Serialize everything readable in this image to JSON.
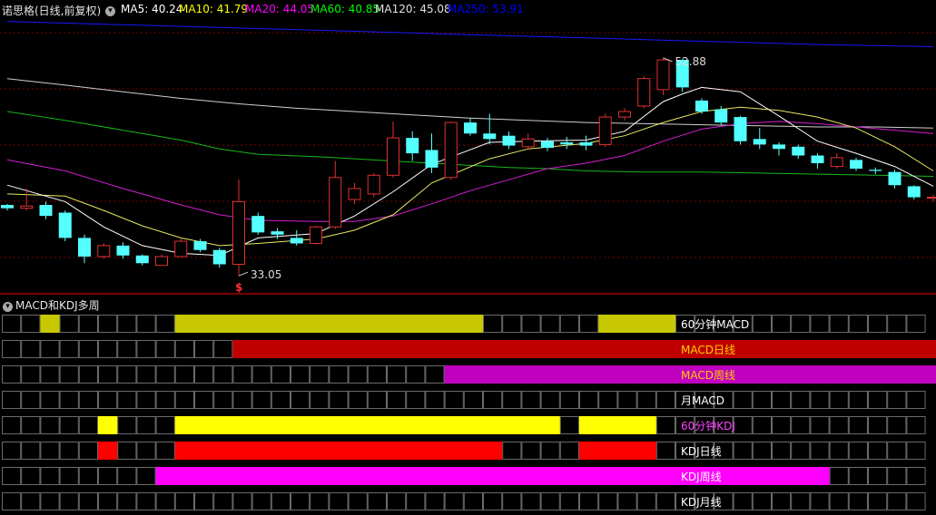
{
  "header": {
    "title": "诺思格(日线,前复权)",
    "ma": [
      {
        "label": "MA5: 40.24",
        "color": "#ffffff"
      },
      {
        "label": "MA10: 41.79",
        "color": "#ffff00"
      },
      {
        "label": "MA20: 44.05",
        "color": "#ff00ff"
      },
      {
        "label": "MA60: 40.85",
        "color": "#00ff00"
      },
      {
        "label": "MA120: 45.08",
        "color": "#e0e0e0"
      },
      {
        "label": "MA250: 53.91",
        "color": "#0000ff"
      }
    ]
  },
  "chart_data": {
    "type": "candlestick",
    "price_range": [
      31.5,
      56.5
    ],
    "high_label": "52.88",
    "low_label": "33.05",
    "signal_mark": "$",
    "up_color": "#e03030",
    "down_color": "#54ffff",
    "candles": [
      [
        39.5,
        39.2,
        39.6,
        39.0
      ],
      [
        39.2,
        39.4,
        41.0,
        39.0
      ],
      [
        39.5,
        38.5,
        39.8,
        38.2
      ],
      [
        38.8,
        36.5,
        39.0,
        36.2
      ],
      [
        36.5,
        34.8,
        36.8,
        34.2
      ],
      [
        34.8,
        35.8,
        36.0,
        34.6
      ],
      [
        35.8,
        34.9,
        36.1,
        34.6
      ],
      [
        34.9,
        34.2,
        35.0,
        34.0
      ],
      [
        34.0,
        34.8,
        35.0,
        34.0
      ],
      [
        34.8,
        36.2,
        36.5,
        34.8
      ],
      [
        36.2,
        35.4,
        36.4,
        35.2
      ],
      [
        35.4,
        34.1,
        35.6,
        33.8
      ],
      [
        34.1,
        39.8,
        41.8,
        33.05
      ],
      [
        38.5,
        37.0,
        38.8,
        36.8
      ],
      [
        37.1,
        36.8,
        37.4,
        36.4
      ],
      [
        36.5,
        36.0,
        37.2,
        35.8
      ],
      [
        36.0,
        37.5,
        37.6,
        35.9
      ],
      [
        37.5,
        42.0,
        43.5,
        37.3
      ],
      [
        40.0,
        41.0,
        41.5,
        39.6
      ],
      [
        40.5,
        42.2,
        42.4,
        40.2
      ],
      [
        42.2,
        45.6,
        47.1,
        42.0
      ],
      [
        45.6,
        44.2,
        46.2,
        43.5
      ],
      [
        44.5,
        42.9,
        46.0,
        42.4
      ],
      [
        42.0,
        47.0,
        47.1,
        41.8
      ],
      [
        47.0,
        46.0,
        47.4,
        45.8
      ],
      [
        46.0,
        45.5,
        47.8,
        45.0
      ],
      [
        45.8,
        44.9,
        46.2,
        44.6
      ],
      [
        44.8,
        45.5,
        46.0,
        44.5
      ],
      [
        45.3,
        44.7,
        45.6,
        44.4
      ],
      [
        45.2,
        45.0,
        45.7,
        44.6
      ],
      [
        45.2,
        44.9,
        45.8,
        44.5
      ],
      [
        45.0,
        47.5,
        47.8,
        44.8
      ],
      [
        47.5,
        48.0,
        48.3,
        47.2
      ],
      [
        48.5,
        51.0,
        51.2,
        48.3
      ],
      [
        50.0,
        52.7,
        52.88,
        49.5
      ],
      [
        52.7,
        50.2,
        52.8,
        49.8
      ],
      [
        49.0,
        48.0,
        49.2,
        47.8
      ],
      [
        48.2,
        47.0,
        48.5,
        46.8
      ],
      [
        47.5,
        45.3,
        47.6,
        45.0
      ],
      [
        45.5,
        45.0,
        46.5,
        44.6
      ],
      [
        45.0,
        44.6,
        45.2,
        44.0
      ],
      [
        44.8,
        44.0,
        45.0,
        43.7
      ],
      [
        44.0,
        43.3,
        44.2,
        42.8
      ],
      [
        43.0,
        43.8,
        44.2,
        42.8
      ],
      [
        43.6,
        42.8,
        43.8,
        42.6
      ],
      [
        42.7,
        42.6,
        42.9,
        42.3
      ],
      [
        42.5,
        41.3,
        42.7,
        41.0
      ],
      [
        41.2,
        40.2,
        41.3,
        40.0
      ],
      [
        40.2,
        40.2,
        40.4,
        39.8
      ]
    ],
    "ma5": [
      [
        0,
        41.3
      ],
      [
        3,
        39.8
      ],
      [
        5,
        37.5
      ],
      [
        7,
        35.8
      ],
      [
        9,
        35.1
      ],
      [
        11,
        34.9
      ],
      [
        13,
        36.5
      ],
      [
        16,
        36.9
      ],
      [
        18,
        38.5
      ],
      [
        20,
        40.7
      ],
      [
        22,
        43.2
      ],
      [
        25,
        45.2
      ],
      [
        27,
        45.3
      ],
      [
        30,
        45.4
      ],
      [
        32,
        46.2
      ],
      [
        34,
        48.9
      ],
      [
        35,
        49.6
      ],
      [
        36,
        50.2
      ],
      [
        38,
        49.8
      ],
      [
        40,
        47.6
      ],
      [
        42,
        45.3
      ],
      [
        44,
        44.2
      ],
      [
        46,
        43.0
      ],
      [
        48,
        41.2
      ]
    ],
    "ma10": [
      [
        0,
        40.5
      ],
      [
        3,
        40.3
      ],
      [
        5,
        39.0
      ],
      [
        7,
        37.6
      ],
      [
        9,
        36.5
      ],
      [
        11,
        35.8
      ],
      [
        13,
        36.0
      ],
      [
        16,
        36.4
      ],
      [
        18,
        37.2
      ],
      [
        20,
        38.6
      ],
      [
        22,
        41.5
      ],
      [
        25,
        43.7
      ],
      [
        27,
        44.6
      ],
      [
        30,
        45.1
      ],
      [
        32,
        45.8
      ],
      [
        34,
        47.0
      ],
      [
        36,
        48.0
      ],
      [
        38,
        48.4
      ],
      [
        40,
        48.1
      ],
      [
        42,
        47.5
      ],
      [
        44,
        46.5
      ],
      [
        46,
        44.8
      ],
      [
        48,
        42.6
      ]
    ],
    "ma20": [
      [
        0,
        43.6
      ],
      [
        3,
        42.6
      ],
      [
        6,
        41.0
      ],
      [
        9,
        39.5
      ],
      [
        11,
        38.6
      ],
      [
        13,
        38.1
      ],
      [
        16,
        38.0
      ],
      [
        18,
        38.0
      ],
      [
        20,
        38.5
      ],
      [
        22,
        39.6
      ],
      [
        24,
        40.8
      ],
      [
        26,
        41.8
      ],
      [
        28,
        42.8
      ],
      [
        30,
        43.3
      ],
      [
        32,
        44.0
      ],
      [
        34,
        45.3
      ],
      [
        36,
        46.4
      ],
      [
        38,
        46.9
      ],
      [
        40,
        47.1
      ],
      [
        42,
        46.9
      ],
      [
        44,
        46.6
      ],
      [
        46,
        46.3
      ],
      [
        48,
        46.0
      ]
    ],
    "ma60": [
      [
        0,
        48.0
      ],
      [
        3,
        47.2
      ],
      [
        6,
        46.3
      ],
      [
        9,
        45.4
      ],
      [
        11,
        44.6
      ],
      [
        13,
        44.1
      ],
      [
        16,
        43.9
      ],
      [
        18,
        43.7
      ],
      [
        20,
        43.5
      ],
      [
        22,
        43.3
      ],
      [
        24,
        43.1
      ],
      [
        26,
        42.9
      ],
      [
        28,
        42.8
      ],
      [
        30,
        42.6
      ],
      [
        33,
        42.5
      ],
      [
        36,
        42.5
      ],
      [
        39,
        42.4
      ],
      [
        42,
        42.3
      ],
      [
        45,
        42.2
      ],
      [
        48,
        42.1
      ]
    ],
    "ma120": [
      [
        0,
        51.0
      ],
      [
        3,
        50.4
      ],
      [
        6,
        49.8
      ],
      [
        9,
        49.2
      ],
      [
        12,
        48.7
      ],
      [
        15,
        48.3
      ],
      [
        18,
        48.0
      ],
      [
        21,
        47.7
      ],
      [
        24,
        47.4
      ],
      [
        27,
        47.2
      ],
      [
        30,
        47.0
      ],
      [
        33,
        46.9
      ],
      [
        36,
        46.8
      ],
      [
        39,
        46.7
      ],
      [
        42,
        46.6
      ],
      [
        45,
        46.6
      ],
      [
        48,
        46.5
      ]
    ],
    "ma250": [
      [
        0,
        56.2
      ],
      [
        6,
        55.9
      ],
      [
        12,
        55.6
      ],
      [
        18,
        55.3
      ],
      [
        24,
        55.0
      ],
      [
        30,
        54.7
      ],
      [
        36,
        54.4
      ],
      [
        42,
        54.1
      ],
      [
        48,
        53.9
      ]
    ]
  },
  "subpanel": {
    "title": "MACD和KDJ多周",
    "rows": [
      {
        "label": "60分钟MACD",
        "label_color": "#ffffff",
        "bar_color": "#c8c800",
        "segments": [
          [
            2,
            2
          ],
          [
            9,
            24
          ],
          [
            31,
            34
          ]
        ]
      },
      {
        "label": "MACD日线",
        "label_color": "#ffcc00",
        "bar_color": "#c00000",
        "segments": [
          [
            12,
            48
          ]
        ]
      },
      {
        "label": "MACD周线",
        "label_color": "#ffcc00",
        "bar_color": "#c000c0",
        "segments": [
          [
            23,
            48
          ]
        ]
      },
      {
        "label": "月MACD",
        "label_color": "#ffffff",
        "bar_color": "#000000",
        "segments": []
      },
      {
        "label": "60分钟KDJ",
        "label_color": "#ff44ff",
        "bar_color": "#ffff00",
        "segments": [
          [
            5,
            5
          ],
          [
            9,
            28
          ],
          [
            30,
            33
          ]
        ]
      },
      {
        "label": "KDJ日线",
        "label_color": "#ffffff",
        "bar_color": "#ff0000",
        "segments": [
          [
            5,
            5
          ],
          [
            9,
            25
          ],
          [
            30,
            33
          ]
        ]
      },
      {
        "label": "KDJ周线",
        "label_color": "#ffffff",
        "bar_color": "#ff00ff",
        "segments": [
          [
            8,
            42
          ]
        ]
      },
      {
        "label": "KDJ月线",
        "label_color": "#ffffff",
        "bar_color": "#000000",
        "segments": []
      }
    ]
  }
}
